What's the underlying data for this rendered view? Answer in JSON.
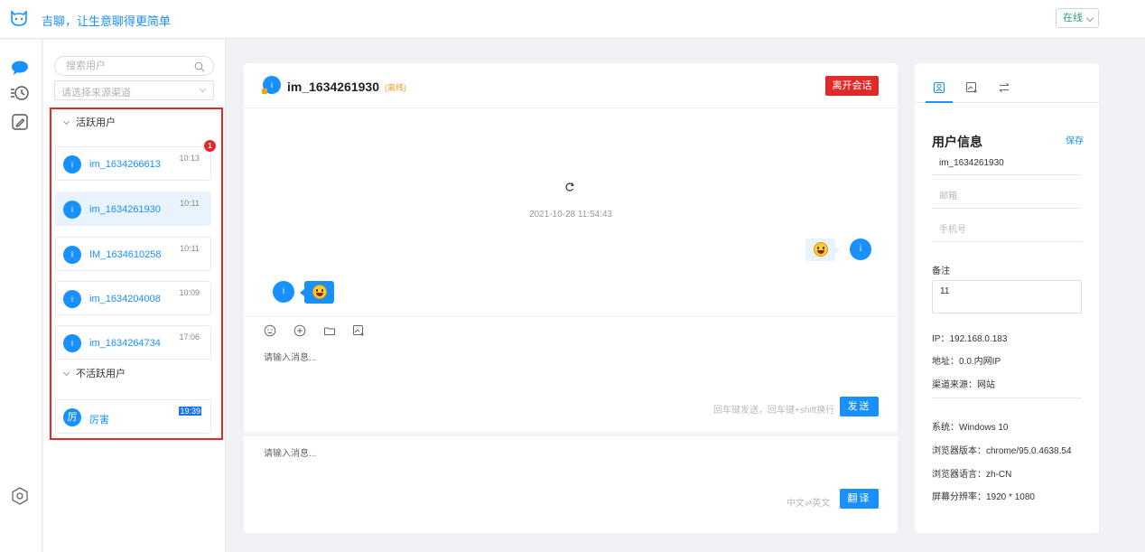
{
  "header": {
    "title": "吉聊，让生意聊得更简单",
    "status": "在线"
  },
  "userlist": {
    "search_placeholder": "搜索用户",
    "source_placeholder": "请选择来源渠道",
    "active_group": "活跃用户",
    "inactive_group": "不活跃用户",
    "active_users": [
      {
        "avatar": "i",
        "name": "im_1634266613",
        "time": "10:13",
        "badge": "1"
      },
      {
        "avatar": "i",
        "name": "im_1634261930",
        "time": "10:11"
      },
      {
        "avatar": "I",
        "name": "IM_1634610258",
        "time": "10:11"
      },
      {
        "avatar": "i",
        "name": "im_1634204008",
        "time": "10:09"
      },
      {
        "avatar": "i",
        "name": "im_1634264734",
        "time": "17:06"
      }
    ],
    "inactive_users": [
      {
        "avatar": "厉",
        "name": "厉害",
        "time": "19:39"
      }
    ]
  },
  "chat": {
    "title": "im_1634261930",
    "status": "(离线)",
    "leave_label": "离开会话",
    "timestamp": "2021-10-28 11:54:43",
    "my_avatar": "i",
    "peer_avatar": "i",
    "input_placeholder": "请输入消息...",
    "send_hint": "回车键发送，回车键+shift换行",
    "send_label": "发送",
    "translate_placeholder": "请输入消息...",
    "lang_pair": "中文⇌英文",
    "translate_label": "翻译"
  },
  "info": {
    "title": "用户信息",
    "save_label": "保存",
    "username": "im_1634261930",
    "email_placeholder": "邮箱",
    "phone_placeholder": "手机号",
    "notes_label": "备注",
    "notes_value": "11",
    "ip": "IP：192.168.0.183",
    "address": "地址：0.0.内网IP",
    "channel": "渠道来源：网站",
    "os": "系统：Windows 10",
    "browser": "浏览器版本：chrome/95.0.4638.54",
    "language": "浏览器语言：zh-CN",
    "resolution": "屏幕分辨率：1920 * 1080"
  },
  "colors": {
    "accent": "#1890ff",
    "danger": "#e02a2a",
    "online": "#29a36a",
    "offline": "#f0a020"
  },
  "icons": [
    "logo-icon",
    "chat-icon",
    "history-icon",
    "edit-icon",
    "settings-icon",
    "search-icon",
    "refresh-icon",
    "emoji-icon",
    "add-icon",
    "folder-icon",
    "image-add-icon",
    "user-profile-icon",
    "image-add-tab-icon",
    "transfer-icon"
  ]
}
